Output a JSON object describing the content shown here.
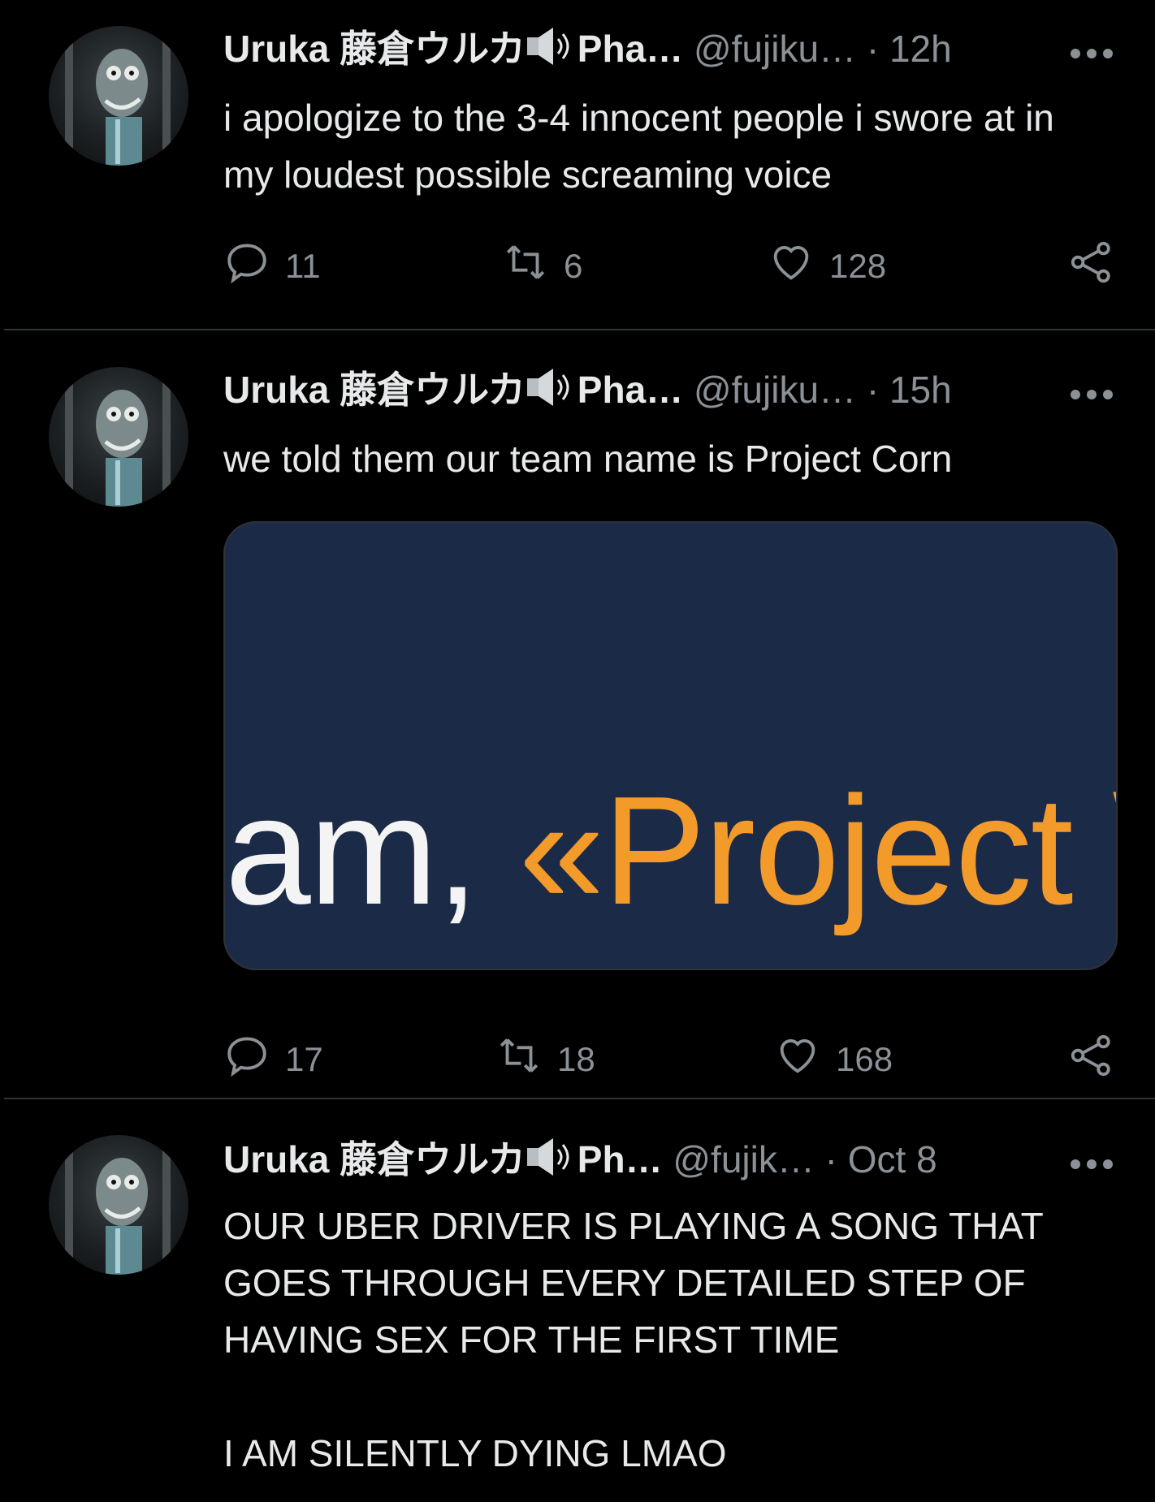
{
  "tweets": [
    {
      "display_name": "Uruka 藤倉ウルカ",
      "name_suffix": "Pha…",
      "handle": "@fujiku…",
      "separator": "·",
      "time": "12h",
      "text": "i apologize to the 3-4 innocent people i swore at in my loudest possible screaming voice",
      "replies": "11",
      "retweets": "6",
      "likes": "128"
    },
    {
      "display_name": "Uruka 藤倉ウルカ",
      "name_suffix": "Pha…",
      "handle": "@fujiku…",
      "separator": "·",
      "time": "15h",
      "text": "we told them our team name is Project Corn",
      "media": {
        "text_white": "am, ",
        "text_orange": "«Project \\"
      },
      "replies": "17",
      "retweets": "18",
      "likes": "168"
    },
    {
      "display_name": "Uruka 藤倉ウルカ",
      "name_suffix": "Ph…",
      "handle": "@fujik…",
      "separator": "·",
      "time": "Oct 8",
      "text": "OUR UBER DRIVER IS PLAYING A SONG THAT GOES THROUGH EVERY DETAILED STEP OF HAVING SEX FOR THE FIRST TIME\n\nI AM SILENTLY DYING LMAO"
    }
  ],
  "colors": {
    "background": "#000000",
    "text": "#e7e9ea",
    "muted": "#8b9196",
    "media_bg": "#1b2a47",
    "accent_orange": "#f29a2a"
  }
}
